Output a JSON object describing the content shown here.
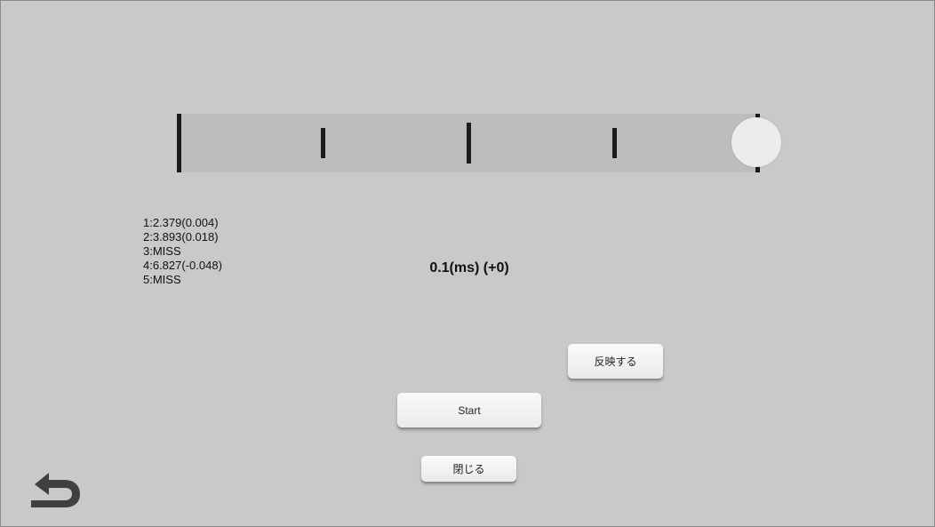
{
  "timeline": {
    "ticks": [
      "small",
      "big",
      "small"
    ]
  },
  "results": [
    "1:2.379(0.004)",
    "2:3.893(0.018)",
    "3:MISS",
    "4:6.827(-0.048)",
    "5:MISS"
  ],
  "offset_display": "0.1(ms) (+0)",
  "buttons": {
    "apply_label": "反映する",
    "start_label": "Start",
    "close_label": "閉じる"
  },
  "icons": {
    "back": "back-arrow-icon"
  }
}
